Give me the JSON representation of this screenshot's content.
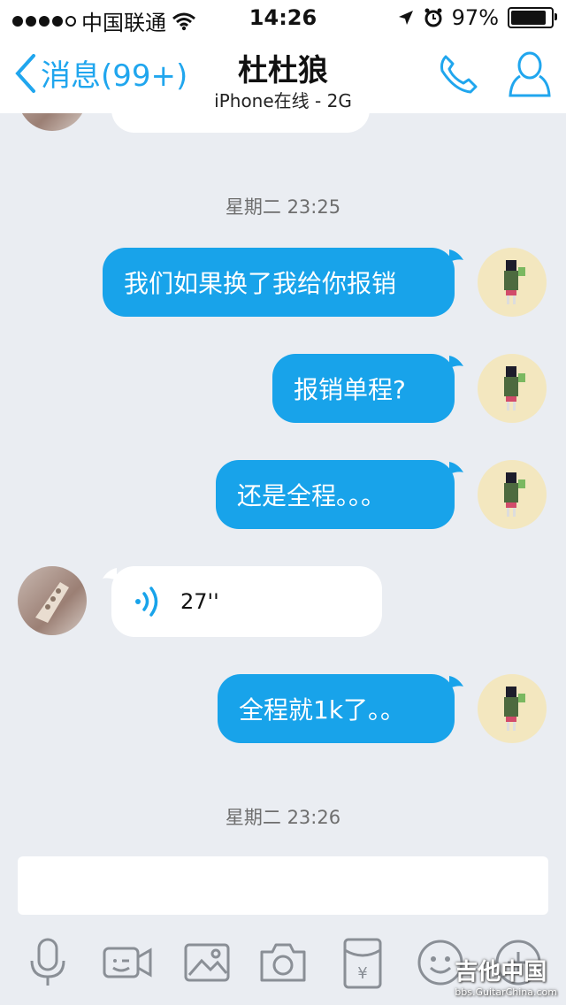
{
  "status": {
    "carrier": "中国联通",
    "time": "14:26",
    "battery": "97%",
    "battery_level": 0.97
  },
  "nav": {
    "back_label": "消息(99+)",
    "title": "杜杜狼",
    "subtitle": "iPhone在线 - 2G"
  },
  "chat": {
    "timestamps": [
      "星期二 23:25",
      "星期二 23:26"
    ],
    "messages": [
      {
        "from": "me",
        "text": "我们如果换了我给你报销"
      },
      {
        "from": "me",
        "text": "报销单程?"
      },
      {
        "from": "me",
        "text": "还是全程。。。"
      },
      {
        "from": "peer",
        "type": "voice",
        "text": "27''"
      },
      {
        "from": "me",
        "text": "全程就1k了。。"
      }
    ]
  },
  "toolbar": {
    "items": [
      "microphone-icon",
      "video-call-icon",
      "image-icon",
      "camera-icon",
      "red-packet-icon",
      "emoji-icon",
      "plus-icon"
    ]
  },
  "watermark": {
    "main": "吉他中国",
    "sub": "bbs.GuitarChina.com"
  },
  "colors": {
    "accent": "#20a6ee",
    "bubble_out": "#18a3ea",
    "chat_bg": "#eaedf2"
  }
}
